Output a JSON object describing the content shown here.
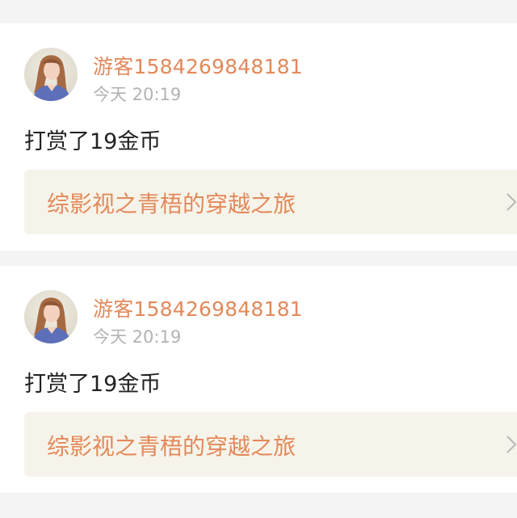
{
  "feed": {
    "items": [
      {
        "username": "游客1584269848181",
        "timestamp": "今天 20:19",
        "message": "打赏了19金币",
        "book_title": "综影视之青梧的穿越之旅"
      },
      {
        "username": "游客1584269848181",
        "timestamp": "今天 20:19",
        "message": "打赏了19金币",
        "book_title": "综影视之青梧的穿越之旅"
      }
    ]
  },
  "icons": {
    "avatar": "avatar-photo-icon",
    "chevron": "chevron-right-icon"
  },
  "colors": {
    "accent": "#e3895a",
    "muted_text": "#b3b3b3",
    "body_text": "#222222",
    "book_link_bg": "#f6f4ea",
    "page_bg": "#f4f4f4",
    "card_bg": "#ffffff"
  }
}
